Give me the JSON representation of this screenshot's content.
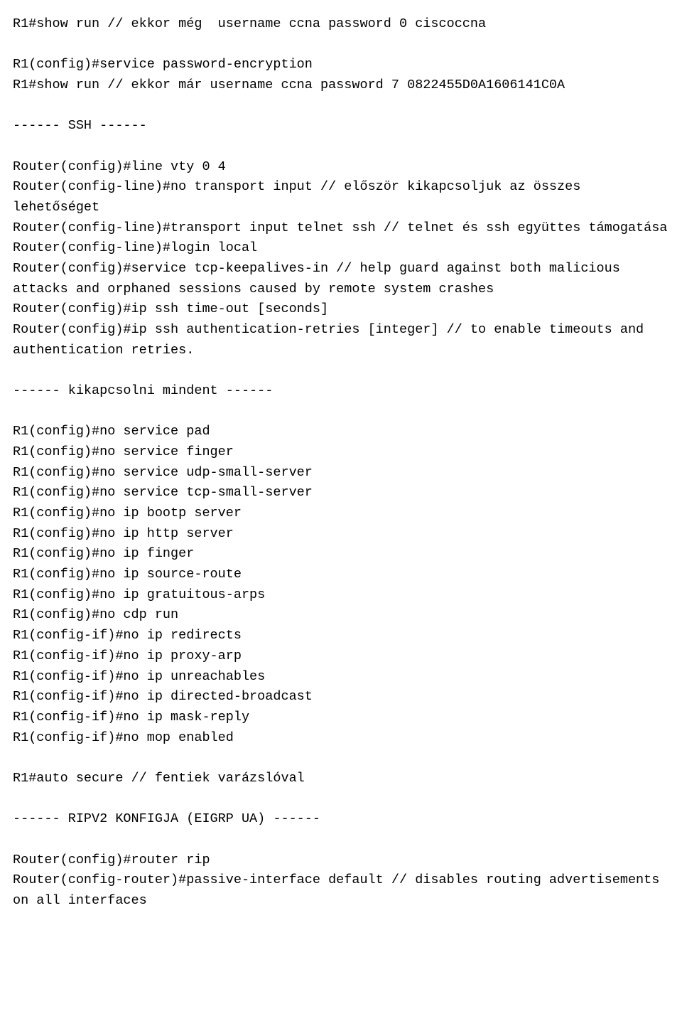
{
  "lines": [
    "R1#show run // ekkor még  username ccna password 0 ciscoccna",
    "",
    "R1(config)#service password-encryption",
    "R1#show run // ekkor már username ccna password 7 0822455D0A1606141C0A",
    "",
    "------ SSH ------",
    "",
    "Router(config)#line vty 0 4",
    "Router(config-line)#no transport input // először kikapcsoljuk az összes lehetőséget",
    "Router(config-line)#transport input telnet ssh // telnet és ssh együttes támogatása",
    "Router(config-line)#login local",
    "Router(config)#service tcp-keepalives-in // help guard against both malicious attacks and orphaned sessions caused by remote system crashes",
    "Router(config)#ip ssh time-out [seconds]",
    "Router(config)#ip ssh authentication-retries [integer] // to enable timeouts and authentication retries.",
    "",
    "------ kikapcsolni mindent ------",
    "",
    "R1(config)#no service pad",
    "R1(config)#no service finger",
    "R1(config)#no service udp-small-server",
    "R1(config)#no service tcp-small-server",
    "R1(config)#no ip bootp server",
    "R1(config)#no ip http server",
    "R1(config)#no ip finger",
    "R1(config)#no ip source-route",
    "R1(config)#no ip gratuitous-arps",
    "R1(config)#no cdp run",
    "R1(config-if)#no ip redirects",
    "R1(config-if)#no ip proxy-arp",
    "R1(config-if)#no ip unreachables",
    "R1(config-if)#no ip directed-broadcast",
    "R1(config-if)#no ip mask-reply",
    "R1(config-if)#no mop enabled",
    "",
    "R1#auto secure // fentiek varázslóval",
    "",
    "------ RIPV2 KONFIGJA (EIGRP UA) ------",
    "",
    "Router(config)#router rip",
    "Router(config-router)#passive-interface default // disables routing advertisements on all interfaces"
  ]
}
